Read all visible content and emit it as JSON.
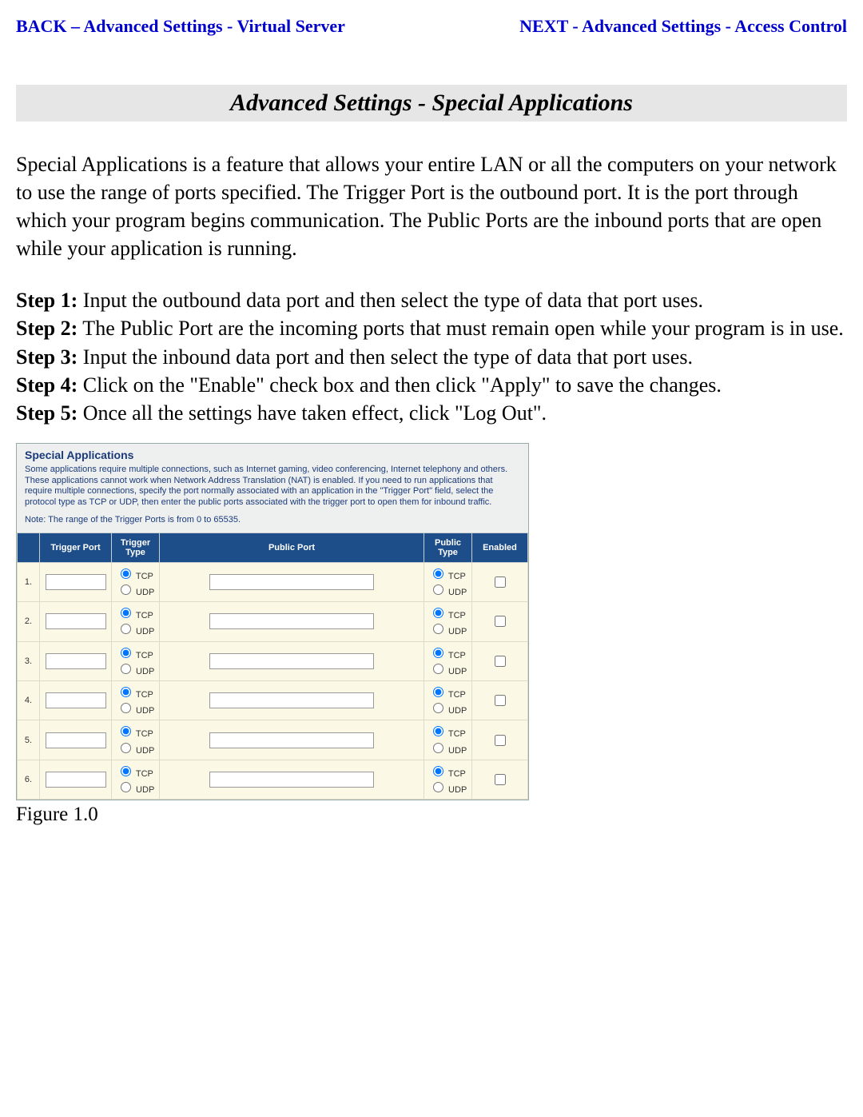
{
  "nav": {
    "back": "BACK – Advanced Settings - Virtual Server",
    "next": "NEXT - Advanced Settings - Access Control"
  },
  "title": "Advanced Settings - Special Applications",
  "intro": "Special Applications is a feature that allows your entire LAN or all the computers on your network to use the range of ports specified. The Trigger Port is the outbound port. It is the port through which your program begins communication. The Public Ports are the inbound ports that are open while your application is running.",
  "steps": [
    {
      "label": "Step 1:",
      "text": "  Input the outbound data port and then select the type of data that port uses."
    },
    {
      "label": "Step 2:",
      "text": "  The Public Port are the incoming ports that must remain open while your program is in use."
    },
    {
      "label": "Step 3:",
      "text": "  Input the inbound data port and then select the type of data that port uses."
    },
    {
      "label": "Step 4:",
      "text": "  Click on the \"Enable\" check box and then click \"Apply\" to save the changes."
    },
    {
      "label": "Step 5:",
      "text": "  Once all the settings have taken effect, click \"Log Out\"."
    }
  ],
  "panel": {
    "title": "Special Applications",
    "desc": "Some applications require multiple connections, such as Internet gaming, video conferencing, Internet telephony and others. These applications cannot work when Network Address Translation (NAT) is enabled. If you need to run applications that require multiple connections, specify the port normally associated with an application in the \"Trigger Port\" field, select the protocol type as TCP or UDP, then enter the public ports associated with the trigger port to open them for inbound traffic.",
    "note": "Note: The range of the Trigger Ports is from 0 to 65535.",
    "headers": {
      "idx": "",
      "trigger_port": "Trigger Port",
      "trigger_type": "Trigger Type",
      "public_port": "Public Port",
      "public_type": "Public Type",
      "enabled": "Enabled"
    },
    "type_options": {
      "tcp": "TCP",
      "udp": "UDP"
    },
    "rows": [
      {
        "idx": "1.",
        "trigger_port": "",
        "trigger_type": "TCP",
        "public_port": "",
        "public_type": "TCP",
        "enabled": false
      },
      {
        "idx": "2.",
        "trigger_port": "",
        "trigger_type": "TCP",
        "public_port": "",
        "public_type": "TCP",
        "enabled": false
      },
      {
        "idx": "3.",
        "trigger_port": "",
        "trigger_type": "TCP",
        "public_port": "",
        "public_type": "TCP",
        "enabled": false
      },
      {
        "idx": "4.",
        "trigger_port": "",
        "trigger_type": "TCP",
        "public_port": "",
        "public_type": "TCP",
        "enabled": false
      },
      {
        "idx": "5.",
        "trigger_port": "",
        "trigger_type": "TCP",
        "public_port": "",
        "public_type": "TCP",
        "enabled": false
      },
      {
        "idx": "6.",
        "trigger_port": "",
        "trigger_type": "TCP",
        "public_port": "",
        "public_type": "TCP",
        "enabled": false
      }
    ]
  },
  "caption": "Figure 1.0"
}
